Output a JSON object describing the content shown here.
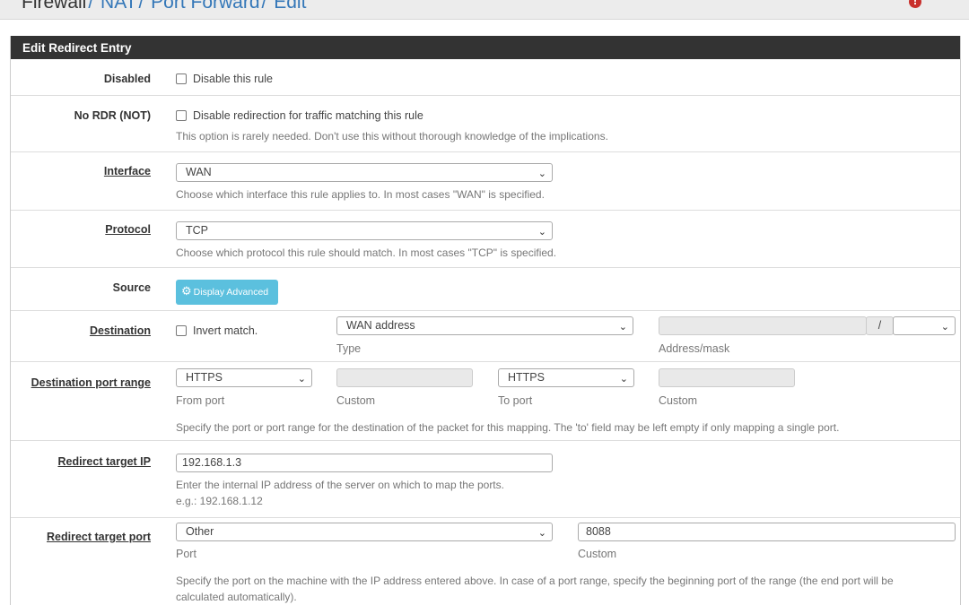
{
  "breadcrumb": {
    "items": [
      "Firewall",
      "NAT",
      "Port Forward",
      "Edit"
    ],
    "separator": "/"
  },
  "help_icon": "help-icon",
  "panel": {
    "title": "Edit Redirect Entry"
  },
  "disabled": {
    "label": "Disabled",
    "checkbox_label": "Disable this rule",
    "checked": false
  },
  "nordr": {
    "label": "No RDR (NOT)",
    "checkbox_label": "Disable redirection for traffic matching this rule",
    "help": "This option is rarely needed. Don't use this without thorough knowledge of the implications.",
    "checked": false
  },
  "interface": {
    "label": "Interface",
    "value": "WAN",
    "help": "Choose which interface this rule applies to. In most cases \"WAN\" is specified."
  },
  "protocol": {
    "label": "Protocol",
    "value": "TCP",
    "help": "Choose which protocol this rule should match. In most cases \"TCP\" is specified."
  },
  "source": {
    "label": "Source",
    "button": "Display Advanced"
  },
  "destination": {
    "label": "Destination",
    "invert_label": "Invert match.",
    "type_value": "WAN address",
    "type_sub": "Type",
    "address_value": "",
    "mask_separator": "/",
    "mask_value": "",
    "address_sub": "Address/mask"
  },
  "dest_port": {
    "label": "Destination port range",
    "from_value": "HTTPS",
    "from_sub": "From port",
    "custom_from_value": "",
    "custom_from_sub": "Custom",
    "to_value": "HTTPS",
    "to_sub": "To port",
    "custom_to_value": "",
    "custom_to_sub": "Custom",
    "help": "Specify the port or port range for the destination of the packet for this mapping. The 'to' field may be left empty if only mapping a single port."
  },
  "target_ip": {
    "label": "Redirect target IP",
    "value": "192.168.1.3",
    "help": "Enter the internal IP address of the server on which to map the ports.",
    "example": "e.g.: 192.168.1.12"
  },
  "target_port": {
    "label": "Redirect target port",
    "port_value": "Other",
    "port_sub": "Port",
    "custom_value": "8088",
    "custom_sub": "Custom",
    "help_line1": "Specify the port on the machine with the IP address entered above. In case of a port range, specify the beginning port of the range (the end port will be",
    "help_line2": "calculated automatically)."
  },
  "colors": {
    "header_bg": "#333333",
    "link": "#3477b8",
    "info_button": "#5bc0de",
    "help_icon": "#c9302c"
  }
}
